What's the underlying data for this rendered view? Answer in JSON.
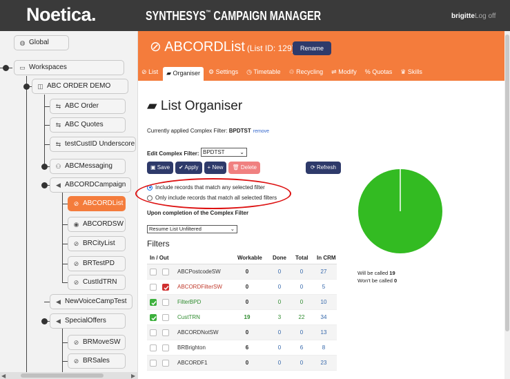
{
  "header": {
    "logo": "Noetica.",
    "app_title": "SYNTHESYS",
    "app_title_mark": "™",
    "app_title_rest": " CAMPAIGN MANAGER",
    "username": "brigitte",
    "logout": "Log off"
  },
  "sidebar": {
    "global": "Global",
    "workspaces": "Workspaces",
    "abc_order_demo": "ABC ORDER DEMO",
    "abc_order": "ABC Order",
    "abc_quotes": "ABC Quotes",
    "testcustid": "testCustID Underscore",
    "abcmessaging": "ABCMessaging",
    "abcordcampaign": "ABCORDCampaign",
    "abcordlist": "ABCORDList",
    "abcordsw": "ABCORDSW",
    "brcitylist": "BRCityList",
    "brtestpd": "BRTestPD",
    "custidtrn": "CustIdTRN",
    "newvoicecamptest": "NewVoiceCampTest",
    "specialoffers": "SpecialOffers",
    "brmovesw": "BRMoveSW",
    "brsales": "BRSales"
  },
  "banner": {
    "list_name": "ABCORDList",
    "list_id": "(List ID: 129)",
    "rename": "Rename"
  },
  "tabs": [
    {
      "label": "List",
      "icon": "eye-slash-icon"
    },
    {
      "label": "Organiser",
      "icon": "book-icon"
    },
    {
      "label": "Settings",
      "icon": "gear-icon"
    },
    {
      "label": "Timetable",
      "icon": "clock-icon"
    },
    {
      "label": "Recycling",
      "icon": "recycle-icon"
    },
    {
      "label": "Modify",
      "icon": "equals-icon"
    },
    {
      "label": "Quotas",
      "icon": "percent-icon"
    },
    {
      "label": "Skills",
      "icon": "trophy-icon"
    }
  ],
  "organiser": {
    "title": "List Organiser",
    "applied_prefix": "Currently applied Complex Filter:",
    "applied_value": "BPDTST",
    "remove": "remove",
    "edit_label": "Edit Complex Filter:",
    "edit_value": "BPDTST",
    "save": "Save",
    "apply": "Apply",
    "new": "New",
    "delete": "Delete",
    "refresh": "Refresh",
    "radio_any": "Include records that match any selected filter",
    "radio_all": "Only include records that match all selected filters",
    "radio_selected": "any",
    "completion_label": "Upon completion of the Complex Filter",
    "completion_value": "Resume List Unfiltered",
    "filters_heading": "Filters"
  },
  "table": {
    "headers": {
      "inout": "In / Out",
      "workable": "Workable",
      "done": "Done",
      "total": "Total",
      "incrm": "In CRM"
    },
    "rows": [
      {
        "name": "ABCPostcodeSW",
        "in": false,
        "out": false,
        "workable": "0",
        "done": "0",
        "total": "0",
        "incrm": "27",
        "color": "#333333"
      },
      {
        "name": "ABCORDFilterSW",
        "in": false,
        "out": true,
        "workable": "0",
        "done": "0",
        "total": "0",
        "incrm": "5",
        "color": "#c0392b"
      },
      {
        "name": "FilterBPD",
        "in": true,
        "out": false,
        "workable": "0",
        "done": "0",
        "total": "0",
        "incrm": "10",
        "color": "#2e8b2e"
      },
      {
        "name": "CustTRN",
        "in": true,
        "out": false,
        "workable": "19",
        "done": "3",
        "total": "22",
        "incrm": "34",
        "color": "#2e8b2e"
      },
      {
        "name": "ABCORDNotSW",
        "in": false,
        "out": false,
        "workable": "0",
        "done": "0",
        "total": "0",
        "incrm": "13",
        "color": "#333333"
      },
      {
        "name": "BRBrighton",
        "in": false,
        "out": false,
        "workable": "6",
        "done": "0",
        "total": "6",
        "incrm": "8",
        "color": "#333333"
      },
      {
        "name": "ABCORDF1",
        "in": false,
        "out": false,
        "workable": "0",
        "done": "0",
        "total": "0",
        "incrm": "23",
        "color": "#333333"
      }
    ]
  },
  "summary": {
    "will_prefix": "Will be called",
    "will_value": "19",
    "wont_prefix": "Won't be called",
    "wont_value": "0"
  },
  "chart_data": {
    "type": "pie",
    "categories": [
      "Will be called",
      "Won't be called"
    ],
    "values": [
      19,
      0
    ],
    "colors": [
      "#33bb22",
      "#e0e0e0"
    ]
  },
  "colors": {
    "accent": "#f47c3c",
    "header": "#3a3a3a",
    "button": "#2e3a6a",
    "delete": "#f08080",
    "green": "#33bb22",
    "annotation": "#dd1111"
  }
}
